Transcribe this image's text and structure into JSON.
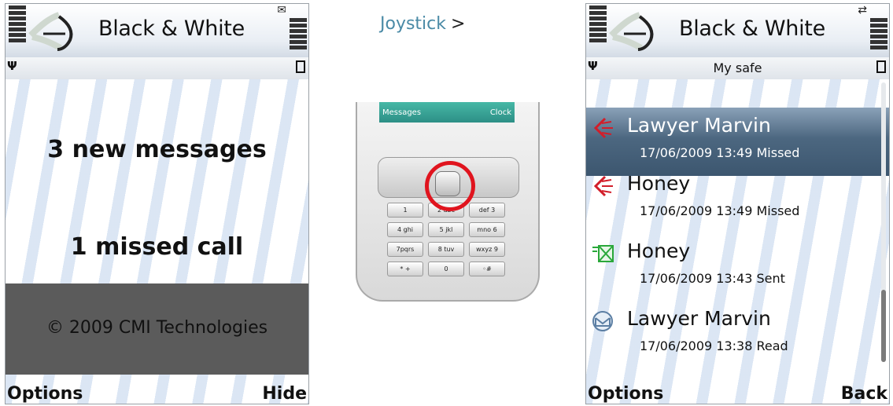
{
  "left": {
    "app_title": "Black & White",
    "message_line1": "3 new messages",
    "message_line2": "1 missed call",
    "copyright": "© 2009 CMI Technologies",
    "softkey_left": "Options",
    "softkey_right": "Hide"
  },
  "middle": {
    "label": "Joystick",
    "arrow": ">",
    "lcd_left": "Messages",
    "lcd_right": "Clock",
    "keys": [
      [
        "1",
        "2 abc",
        "def 3"
      ],
      [
        "4 ghi",
        "5 jkl",
        "mno 6"
      ],
      [
        "7pqrs",
        "8 tuv",
        "wxyz 9"
      ],
      [
        "* +",
        "0",
        "◦#"
      ]
    ]
  },
  "right": {
    "app_title": "Black & White",
    "subtitle": "My safe",
    "softkey_left": "Options",
    "softkey_right": "Back",
    "items": [
      {
        "name": "Lawyer Marvin",
        "detail": "17/06/2009 13:49 Missed",
        "icon": "missed-call-icon",
        "selected": true
      },
      {
        "name": "Honey",
        "detail": "17/06/2009 13:49 Missed",
        "icon": "missed-call-icon",
        "selected": false
      },
      {
        "name": "Honey",
        "detail": "17/06/2009 13:43 Sent",
        "icon": "sent-message-icon",
        "selected": false
      },
      {
        "name": "Lawyer Marvin",
        "detail": "17/06/2009 13:38 Read",
        "icon": "read-message-icon",
        "selected": false
      }
    ]
  },
  "colors": {
    "selection": "#3c566f",
    "footer_band": "#5b5b5b",
    "joystick_highlight": "#e0141e",
    "link_blue": "#4a8aa6"
  }
}
